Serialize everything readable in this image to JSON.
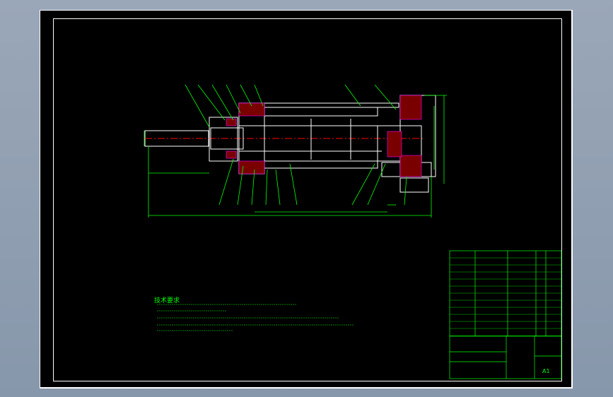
{
  "drawing": {
    "notes_title": "技术要求",
    "scale_label": "A1",
    "colors": {
      "background": "#000000",
      "sheet_border": "#ffffff",
      "geometry": "#ffffff",
      "dimension": "#00ff00",
      "centerline": "#ff0000",
      "hatch": "#ff00ff",
      "title_block": "#00ff00"
    }
  }
}
